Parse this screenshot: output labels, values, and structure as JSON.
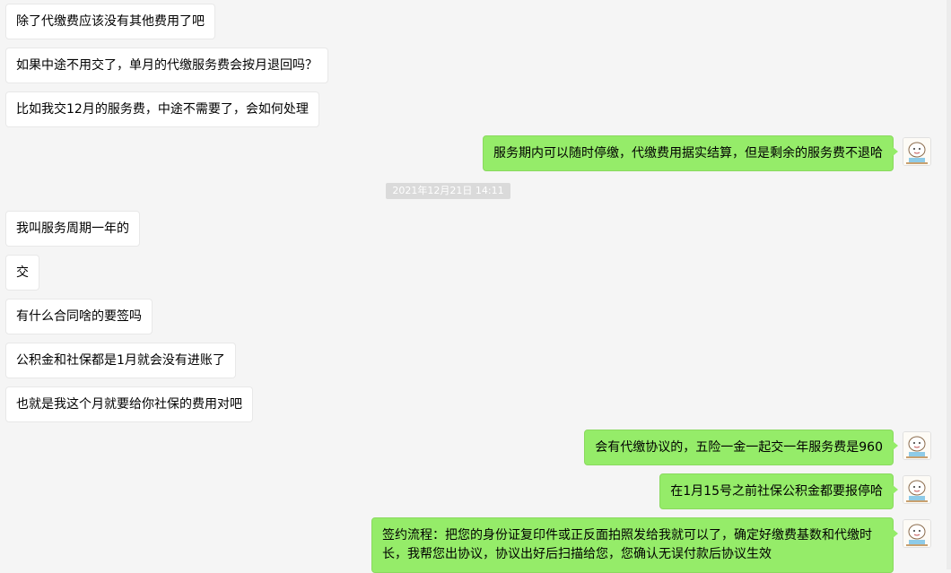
{
  "messages": [
    {
      "side": "left",
      "text": "除了代缴费应该没有其他费用了吧"
    },
    {
      "side": "left",
      "text": "如果中途不用交了，单月的代缴服务费会按月退回吗？"
    },
    {
      "side": "left",
      "text": "比如我交12月的服务费，中途不需要了，会如何处理"
    },
    {
      "side": "right",
      "text": "服务期内可以随时停缴，代缴费用据实结算，但是剩余的服务费不退哈"
    },
    {
      "side": "left",
      "text": "我叫服务周期一年的"
    },
    {
      "side": "left",
      "text": "交"
    },
    {
      "side": "left",
      "text": "有什么合同啥的要签吗"
    },
    {
      "side": "left",
      "text": "公积金和社保都是1月就会没有进账了"
    },
    {
      "side": "left",
      "text": "也就是我这个月就要给你社保的费用对吧"
    },
    {
      "side": "right",
      "text": "会有代缴协议的，五险一金一起交一年服务费是960"
    },
    {
      "side": "right",
      "text": "在1月15号之前社保公积金都要报停哈"
    },
    {
      "side": "right",
      "text": "签约流程：把您的身份证复印件或正反面拍照发给我就可以了，确定好缴费基数和代缴时长，我帮您出协议，协议出好后扫描给您，您确认无误付款后协议生效"
    }
  ],
  "timestamp": "2021年12月21日 14:11",
  "avatar_icon": "cartoon-avatar-icon",
  "colors": {
    "background": "#f5f5f5",
    "incoming_bubble": "#ffffff",
    "outgoing_bubble": "#95ec69",
    "timestamp_bg": "#dadada"
  }
}
